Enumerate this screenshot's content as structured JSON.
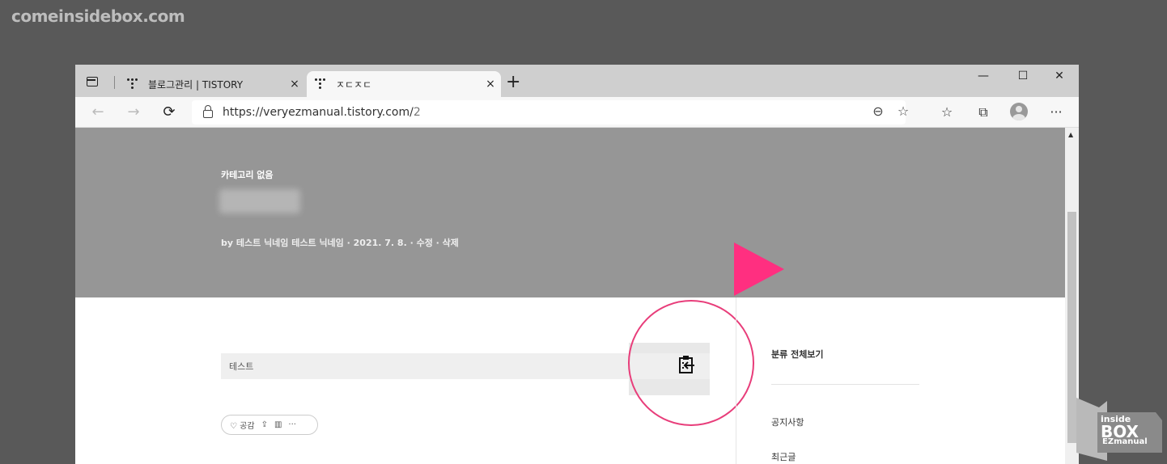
{
  "watermark": "comeinsidebox.com",
  "tabs": [
    {
      "label": "블로그관리 | TISTORY",
      "close": "×"
    },
    {
      "label": "ㅈㄷㅈㄷ",
      "close": "×"
    }
  ],
  "window_controls": {
    "minimize": "—",
    "maximize": "☐",
    "close": "✕"
  },
  "new_tab": "+",
  "address": {
    "url_main": "https://veryezmanual.tistory.com/",
    "url_path": "2"
  },
  "post": {
    "category": "카테고리 없음",
    "meta": "by 테스트 닉네임 테스트 닉네임  ·  2021. 7. 8.  ·  수정  ·  삭제",
    "code_text": "테스트",
    "reaction_label": "공감"
  },
  "sidebar": {
    "all_categories": "분류 전체보기",
    "notice": "공지사항",
    "recent": "최근글"
  },
  "brand_logo": {
    "top": "inside",
    "main": "BOX",
    "bottom": "EZmanual"
  },
  "colors": {
    "accent": "#ff2f80",
    "circle": "#e83d7a"
  }
}
